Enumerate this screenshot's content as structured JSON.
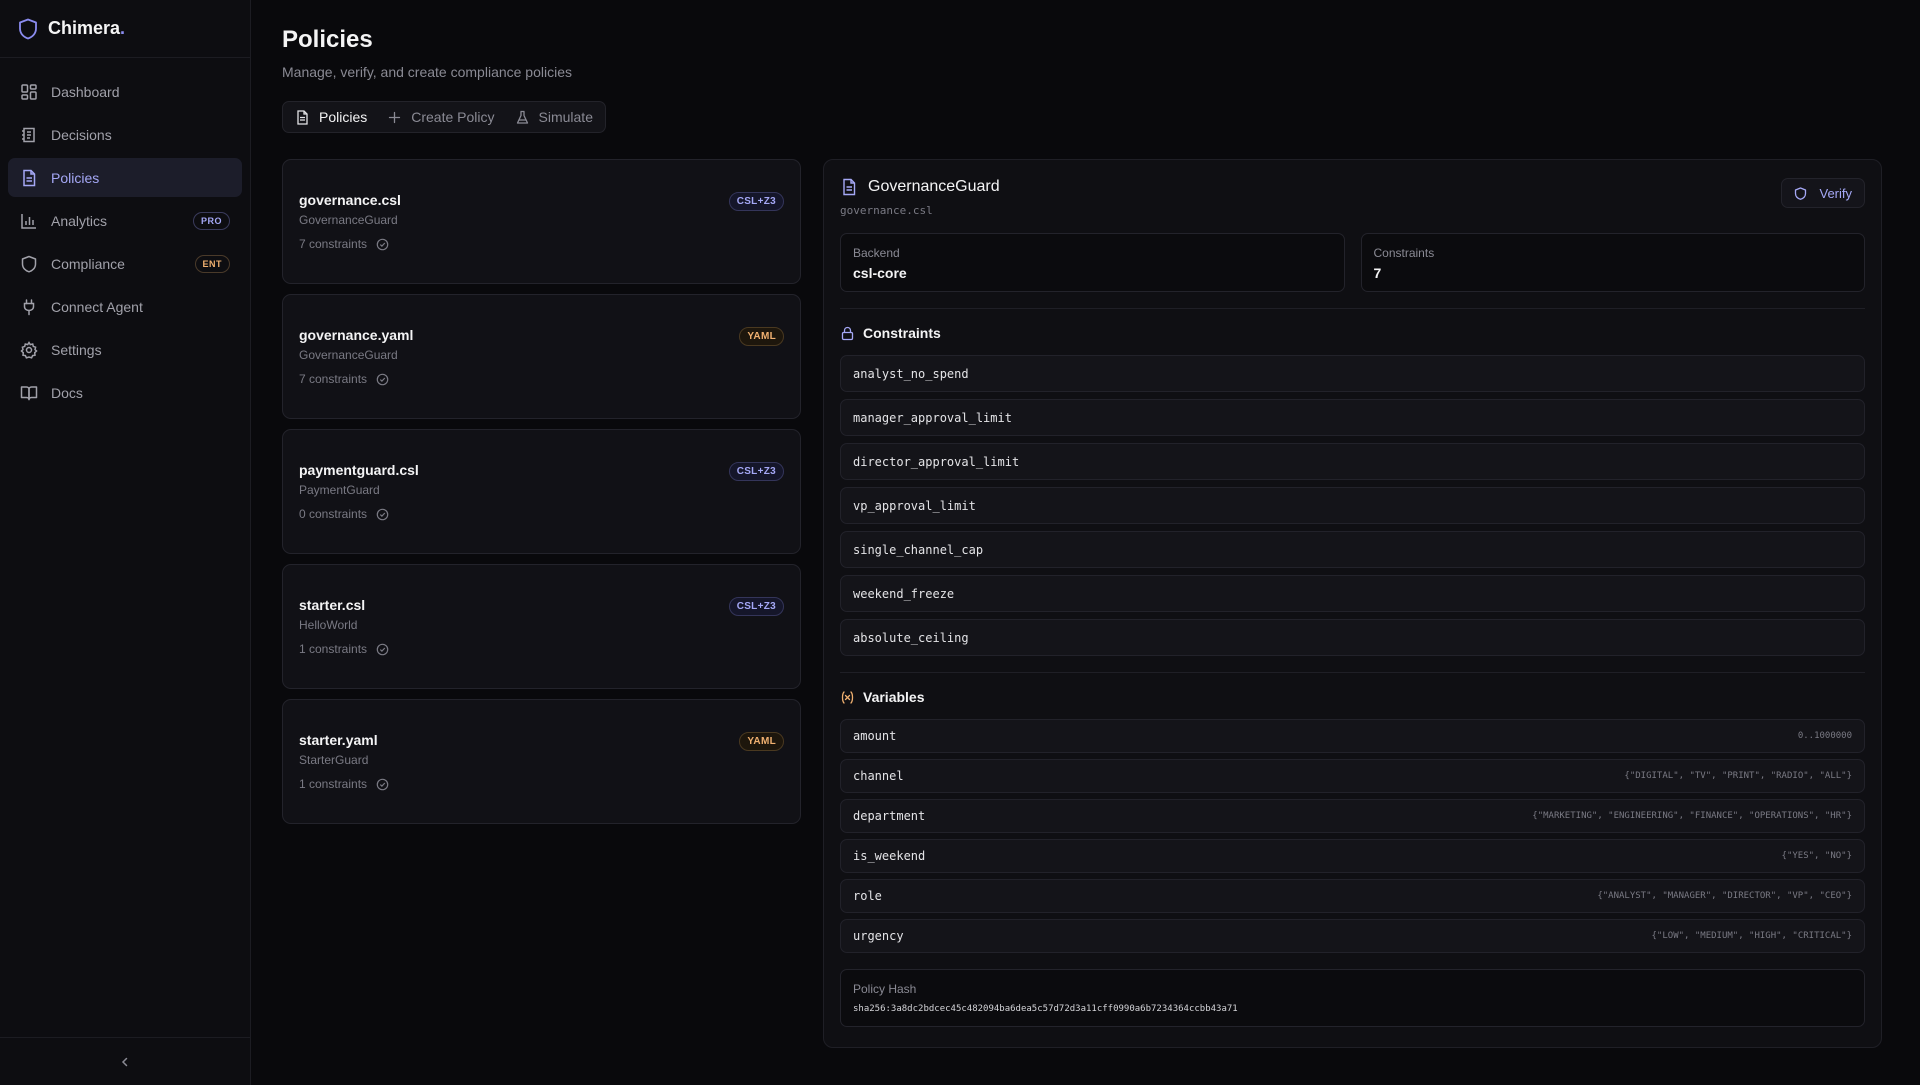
{
  "brand": {
    "name": "Chimera",
    "dot": "."
  },
  "sidebar": {
    "items": [
      {
        "label": "Dashboard",
        "icon": "dashboard-icon"
      },
      {
        "label": "Decisions",
        "icon": "decisions-icon"
      },
      {
        "label": "Policies",
        "icon": "policies-icon",
        "active": true
      },
      {
        "label": "Analytics",
        "icon": "analytics-icon",
        "badge": "PRO"
      },
      {
        "label": "Compliance",
        "icon": "shield-icon",
        "badge": "ENT"
      },
      {
        "label": "Connect Agent",
        "icon": "plug-icon"
      },
      {
        "label": "Settings",
        "icon": "gear-icon"
      },
      {
        "label": "Docs",
        "icon": "book-icon"
      }
    ]
  },
  "header": {
    "title": "Policies",
    "subtitle": "Manage, verify, and create compliance policies"
  },
  "tabs": [
    {
      "label": "Policies",
      "icon": "document-icon",
      "active": true
    },
    {
      "label": "Create Policy",
      "icon": "plus-icon"
    },
    {
      "label": "Simulate",
      "icon": "flask-icon"
    }
  ],
  "policies": [
    {
      "file": "governance.csl",
      "guard": "GovernanceGuard",
      "count": "7 constraints",
      "type": "CSL+Z3"
    },
    {
      "file": "governance.yaml",
      "guard": "GovernanceGuard",
      "count": "7 constraints",
      "type": "YAML"
    },
    {
      "file": "paymentguard.csl",
      "guard": "PaymentGuard",
      "count": "0 constraints",
      "type": "CSL+Z3"
    },
    {
      "file": "starter.csl",
      "guard": "HelloWorld",
      "count": "1 constraints",
      "type": "CSL+Z3"
    },
    {
      "file": "starter.yaml",
      "guard": "StarterGuard",
      "count": "1 constraints",
      "type": "YAML"
    }
  ],
  "detail": {
    "title": "GovernanceGuard",
    "file": "governance.csl",
    "verify_label": "Verify",
    "backend_label": "Backend",
    "backend_value": "csl-core",
    "constraints_label": "Constraints",
    "constraints_value": "7",
    "constraints_heading": "Constraints",
    "constraints": [
      "analyst_no_spend",
      "manager_approval_limit",
      "director_approval_limit",
      "vp_approval_limit",
      "single_channel_cap",
      "weekend_freeze",
      "absolute_ceiling"
    ],
    "variables_heading": "Variables",
    "variables": [
      {
        "name": "amount",
        "domain": "0..1000000"
      },
      {
        "name": "channel",
        "domain": "{\"DIGITAL\", \"TV\", \"PRINT\", \"RADIO\", \"ALL\"}"
      },
      {
        "name": "department",
        "domain": "{\"MARKETING\", \"ENGINEERING\", \"FINANCE\", \"OPERATIONS\", \"HR\"}"
      },
      {
        "name": "is_weekend",
        "domain": "{\"YES\", \"NO\"}"
      },
      {
        "name": "role",
        "domain": "{\"ANALYST\", \"MANAGER\", \"DIRECTOR\", \"VP\", \"CEO\"}"
      },
      {
        "name": "urgency",
        "domain": "{\"LOW\", \"MEDIUM\", \"HIGH\", \"CRITICAL\"}"
      }
    ],
    "hash_label": "Policy Hash",
    "hash_value": "sha256:3a8dc2bdcec45c482094ba6dea5c57d72d3a11cff0990a6b7234364ccbb43a71"
  },
  "colors": {
    "accent": "#a5a8f6",
    "yaml": "#f0b070",
    "background": "#09090c"
  }
}
